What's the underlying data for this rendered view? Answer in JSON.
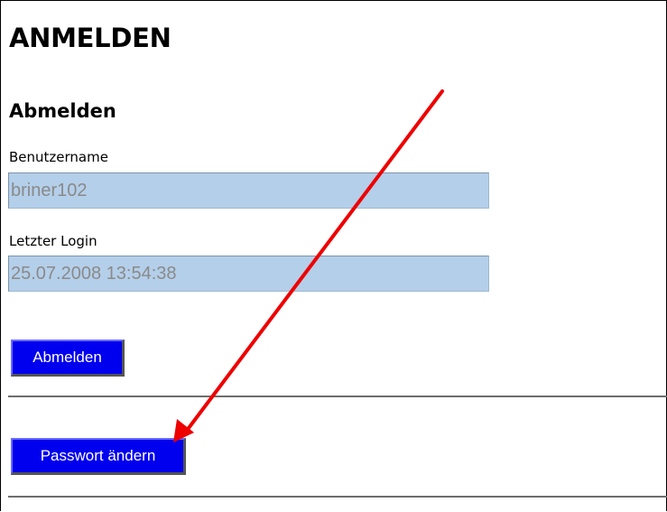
{
  "page": {
    "title": "ANMELDEN",
    "section_title": "Abmelden"
  },
  "fields": [
    {
      "label": "Benutzername",
      "value": "briner102"
    },
    {
      "label": "Letzter Login",
      "value": "25.07.2008 13:54:38"
    }
  ],
  "buttons": {
    "logout_label": "Abmelden",
    "change_password_label": "Passwort ändern"
  },
  "colors": {
    "button_bg": "#0000ee",
    "input_bg": "#b4cfea",
    "annotation_arrow": "#ee0000"
  }
}
